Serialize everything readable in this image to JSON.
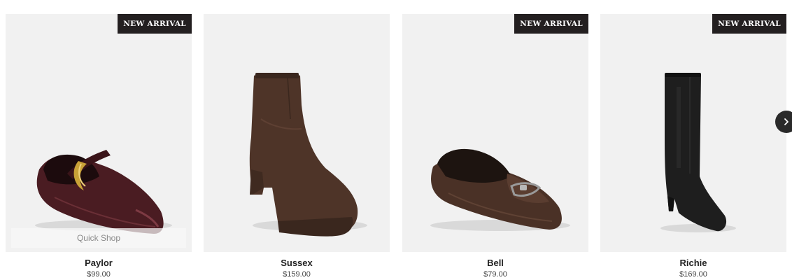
{
  "products": [
    {
      "name": "Paylor",
      "price": "$99.00",
      "badge": "NEW ARRIVAL",
      "quick_shop": "Quick Shop",
      "image_icon": "mary-jane-flat-icon",
      "color": "#4a1c22"
    },
    {
      "name": "Sussex",
      "price": "$159.00",
      "badge": "",
      "image_icon": "ankle-boot-icon",
      "color": "#4e3428"
    },
    {
      "name": "Bell",
      "price": "$79.00",
      "badge": "NEW ARRIVAL",
      "image_icon": "loafer-icon",
      "color": "#4a3126"
    },
    {
      "name": "Richie",
      "price": "$169.00",
      "badge": "NEW ARRIVAL",
      "image_icon": "knee-boot-icon",
      "color": "#1e1e1e"
    }
  ],
  "carousel": {
    "next_icon": "chevron-right-icon"
  }
}
